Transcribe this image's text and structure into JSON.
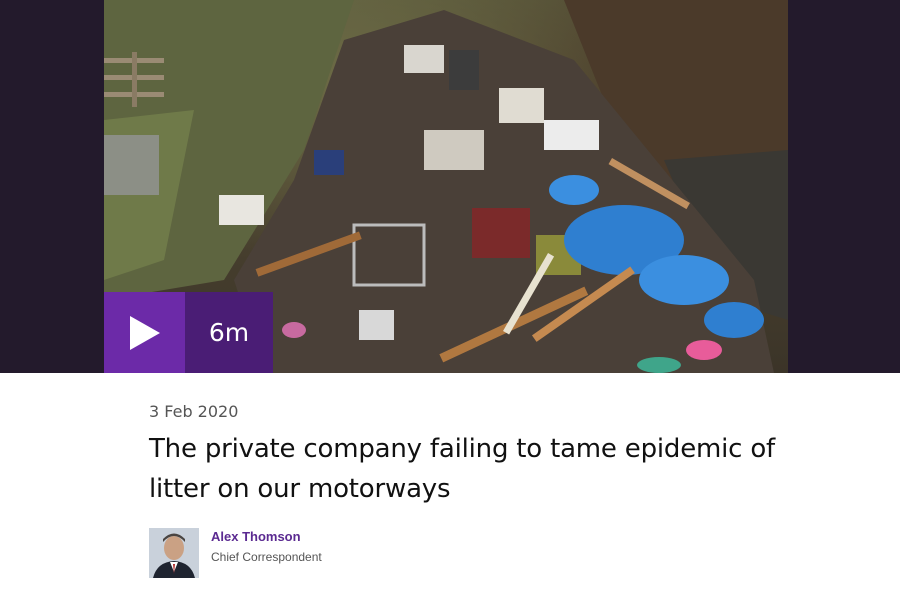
{
  "video": {
    "duration": "6m",
    "play_icon": "play-icon"
  },
  "article": {
    "date": "3 Feb 2020",
    "headline": "The private company failing to tame epidemic of litter on our motorways"
  },
  "author": {
    "name": "Alex Thomson",
    "role": "Chief Correspondent"
  },
  "colors": {
    "play_bg": "#6c2aa8",
    "duration_bg": "#4a1d75",
    "author_link": "#5b2a91",
    "hero_frame": "#231a2c"
  }
}
